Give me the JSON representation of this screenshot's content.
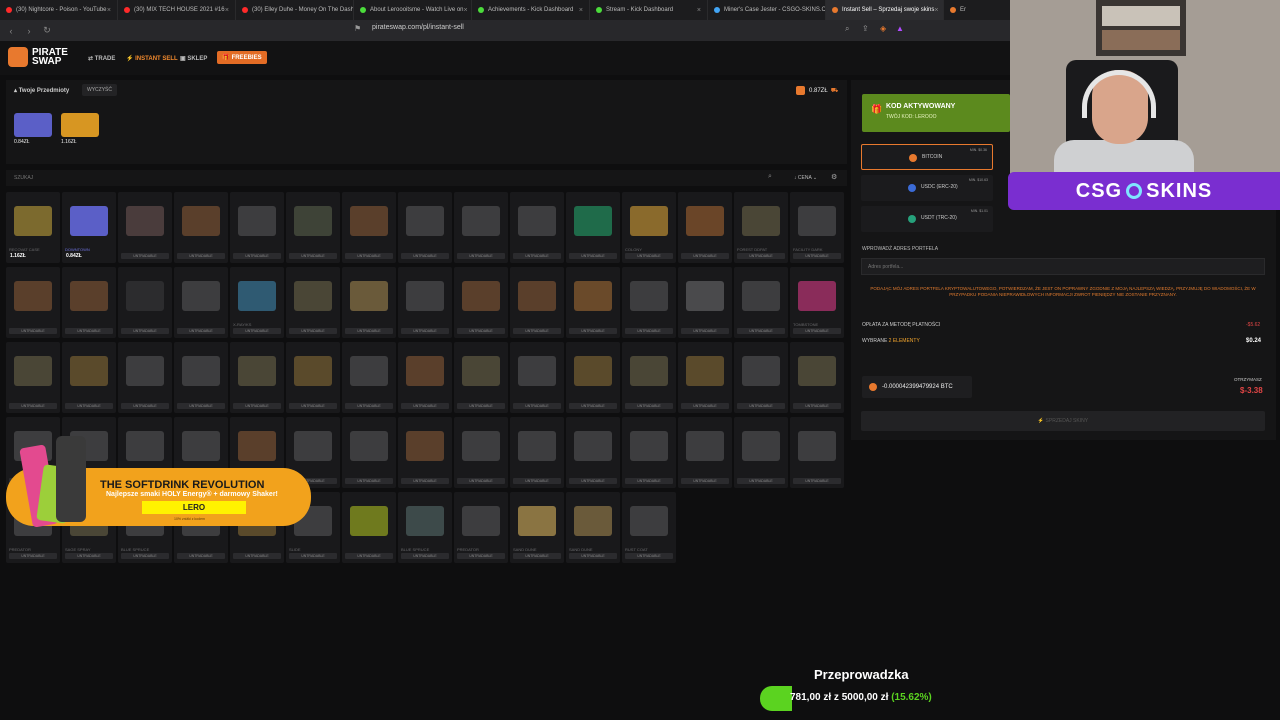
{
  "browser": {
    "tabs": [
      {
        "label": "(30) Nightcore - Poison - YouTube",
        "color": "#ff2a2a"
      },
      {
        "label": "(30) MIX TECH HOUSE 2021 #16",
        "color": "#ff2a2a"
      },
      {
        "label": "(30) Elley Duhe - Money On The Dash",
        "color": "#ff2a2a"
      },
      {
        "label": "About Leroooitsme - Watch Live on",
        "color": "#4bdc3b"
      },
      {
        "label": "Achievements - Kick Dashboard",
        "color": "#4bdc3b"
      },
      {
        "label": "Stream - Kick Dashboard",
        "color": "#4bdc3b"
      },
      {
        "label": "Miner's Case Jester - CSGO-SKINS.C",
        "color": "#42a5f5"
      },
      {
        "label": "Instant Sell – Sprzedaj swoje skins",
        "color": "#e8792e"
      },
      {
        "label": "Er",
        "color": "#e8792e"
      }
    ],
    "active_tab": 7,
    "url": "pirateswap.com/pl/instant-sell"
  },
  "site": {
    "logo_text": "PIRATE SWAP",
    "nav": {
      "trade": "TRADE",
      "instant_sell": "INSTANT SELL",
      "shop": "SKLEP",
      "freebies": "FREEBIES"
    }
  },
  "inventory": {
    "title": "Twoje Przedmioty",
    "clear": "WYCZYŚĆ",
    "total": "0.87ZŁ",
    "selected": [
      {
        "price": "0.84ZŁ",
        "color": "#5b5fc7"
      },
      {
        "price": "1.16ZŁ",
        "color": "#d79622"
      }
    ]
  },
  "search": {
    "placeholder": "SZUKAJ",
    "sort": "↓ CENA ⌄"
  },
  "items": {
    "untradable": "UNTRADABLE",
    "row1": [
      {
        "name": "RECOVAT CASE",
        "price": "1.16ZŁ",
        "color": "#7c6a2e"
      },
      {
        "name": "DOWNTOWN",
        "price": "0.84ZŁ",
        "color": "#5b5fc7"
      },
      {
        "name": "",
        "color": "#4a3c3c"
      },
      {
        "name": "",
        "color": "#5a3f2b"
      },
      {
        "name": "",
        "color": "#3d3d3f"
      },
      {
        "name": "",
        "color": "#3e4337"
      },
      {
        "name": "",
        "color": "#5a3f2b"
      },
      {
        "name": "",
        "color": "#3d3d3f"
      },
      {
        "name": "",
        "color": "#3d3d3f"
      },
      {
        "name": "",
        "color": "#3d3d3f"
      },
      {
        "name": "",
        "color": "#1f6b4a"
      },
      {
        "name": "COLONY",
        "color": "#8a6a2c"
      },
      {
        "name": "",
        "color": "#6a4528"
      },
      {
        "name": "FOREST DDPAT",
        "color": "#4a4636"
      },
      {
        "name": "FACILITY DARK",
        "color": "#3d3d3f"
      }
    ],
    "row2": [
      {
        "name": "",
        "color": "#5a3f2b"
      },
      {
        "name": "",
        "color": "#5a3f2b"
      },
      {
        "name": "",
        "color": "#2c2c2e"
      },
      {
        "name": "",
        "color": "#3d3d3f"
      },
      {
        "name": "X-RAY/KS",
        "color": "#2f5a72"
      },
      {
        "name": "",
        "color": "#4a4636"
      },
      {
        "name": "",
        "color": "#6a5a3a"
      },
      {
        "name": "",
        "color": "#3d3d3f"
      },
      {
        "name": "",
        "color": "#5a3f2b"
      },
      {
        "name": "",
        "color": "#5a3f2b"
      },
      {
        "name": "",
        "color": "#6a4a2a"
      },
      {
        "name": "",
        "color": "#3d3d3f"
      },
      {
        "name": "",
        "color": "#4a4a4c"
      },
      {
        "name": "",
        "color": "#3d3d3f"
      },
      {
        "name": "TOMBSTONE",
        "color": "#8a2c5a"
      }
    ],
    "row3": [
      {
        "name": "",
        "color": "#4a4636"
      },
      {
        "name": "",
        "color": "#5a4a2b"
      },
      {
        "name": "",
        "color": "#3d3d3f"
      },
      {
        "name": "",
        "color": "#3d3d3f"
      },
      {
        "name": "",
        "color": "#4a4636"
      },
      {
        "name": "",
        "color": "#5a4a2b"
      },
      {
        "name": "",
        "color": "#3d3d3f"
      },
      {
        "name": "",
        "color": "#5a3f2b"
      },
      {
        "name": "",
        "color": "#4a4636"
      },
      {
        "name": "",
        "color": "#3d3d3f"
      },
      {
        "name": "",
        "color": "#5a4a2b"
      },
      {
        "name": "",
        "color": "#4a4636"
      },
      {
        "name": "",
        "color": "#5a4a2b"
      },
      {
        "name": "",
        "color": "#3d3d3f"
      },
      {
        "name": "",
        "color": "#4a4636"
      }
    ],
    "row4": [
      {
        "name": "",
        "color": "#3d3d3f"
      },
      {
        "name": "",
        "color": "#3d3d3f"
      },
      {
        "name": "",
        "color": "#3d3d3f"
      },
      {
        "name": "",
        "color": "#3d3d3f"
      },
      {
        "name": "",
        "color": "#5a3f2b"
      },
      {
        "name": "",
        "color": "#3d3d3f"
      },
      {
        "name": "",
        "color": "#3d3d3f"
      },
      {
        "name": "",
        "color": "#5a3f2b"
      },
      {
        "name": "",
        "color": "#3d3d3f"
      },
      {
        "name": "",
        "color": "#3d3d3f"
      },
      {
        "name": "",
        "color": "#3d3d3f"
      },
      {
        "name": "",
        "color": "#3d3d3f"
      },
      {
        "name": "",
        "color": "#3d3d3f"
      },
      {
        "name": "",
        "color": "#3d3d3f"
      },
      {
        "name": "",
        "color": "#3d3d3f"
      }
    ],
    "row5": [
      {
        "name": "PREDATOR",
        "color": "#3d3d3f"
      },
      {
        "name": "SAGE SPRAY",
        "color": "#4a4636"
      },
      {
        "name": "BLUE SPRUCE",
        "color": "#3d3d3f"
      },
      {
        "name": "",
        "color": "#3d3d3f"
      },
      {
        "name": "",
        "color": "#5a4a2b"
      },
      {
        "name": "SLIDE",
        "color": "#3d3d3f"
      },
      {
        "name": "",
        "color": "#6f7a1e"
      },
      {
        "name": "BLUE SPRUCE",
        "color": "#3d4a4a"
      },
      {
        "name": "PREDATOR",
        "color": "#3d3d3f"
      },
      {
        "name": "SAND DUNE",
        "color": "#8a7442"
      },
      {
        "name": "SAND DUNE",
        "color": "#6a5a3a"
      },
      {
        "name": "RUST COAT",
        "color": "#3d3d3f"
      }
    ]
  },
  "payment": {
    "banner_title": "KOD AKTYWOWANY",
    "banner_code": "TWÓJ KOD: LEROOO",
    "methods": [
      {
        "name": "BITCOIN",
        "min": "MIN. $0.36",
        "color": "#e8792e",
        "active": true
      },
      {
        "name": "USDC (ERC-20)",
        "min": "MIN. $10.63",
        "color": "#3b6bd6",
        "active": false
      },
      {
        "name": "USDT (TRC-20)",
        "min": "MIN. $1.01",
        "color": "#26a17b",
        "active": false
      }
    ],
    "wallet_label": "WPROWADŹ ADRES PORTFELA",
    "wallet_placeholder": "Adres portfela...",
    "warning": "PODAJĄC MÓJ ADRES PORTFELA KRYPTOWALUTOWEGO, POTWIERDZAM, ŻE JEST ON POPRAWNY ZGODNIE Z MOJĄ NAJLEPSZĄ WIEDZĄ. PRZYJMUJĘ DO WIADOMOŚCI, ŻE W PRZYPADKU PODANIA NIEPRAWIDŁOWYCH INFORMACJI ZWROT PIENIĘDZY NIE ZOSTANIE PRZYZNANY.",
    "fee_label": "OPŁATA ZA METODĘ PŁATNOŚCI",
    "fee_value": "-$5.62",
    "selected_label": "WYBRANE",
    "selected_count": "2 ELEMENTY",
    "selected_value": "$0.24",
    "btc_amount": "-0.000042399479924 BTC",
    "receive_label": "OTRZYMASZ",
    "receive_value": "$-3.38",
    "sell_button": "SPRZEDAJ SKINY"
  },
  "overlay": {
    "sponsor": "CSG SKINS",
    "ad_headline": "THE SOFTDRINK REVOLUTION",
    "ad_sub": "Najlepsze smaki HOLY Energy® + darmowy Shaker!",
    "ad_code": "LERO",
    "ad_small": "10% zniżki z kodem",
    "move_label": "Przeprowadzka",
    "move_progress": "781,00 zł z 5000,00 zł",
    "move_percent": "(15.62%)",
    "move_fraction": 0.1562
  }
}
